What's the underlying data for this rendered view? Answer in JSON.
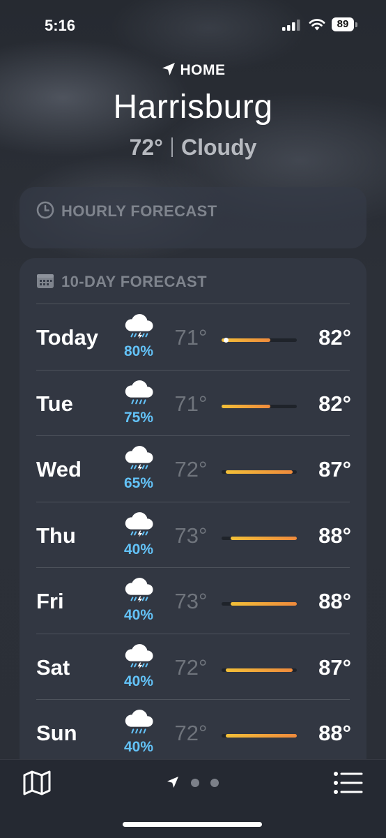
{
  "status_bar": {
    "time": "5:16",
    "battery": "89"
  },
  "header": {
    "location_label": "HOME",
    "city": "Harrisburg",
    "current_temp": "72°",
    "current_condition": "Cloudy"
  },
  "hourly": {
    "title": "HOURLY FORECAST"
  },
  "daily": {
    "title": "10-DAY FORECAST",
    "range_min": 71,
    "range_max": 88,
    "current_temp_value": 72,
    "days": [
      {
        "day": "Today",
        "icon": "thunderstorm-rain-icon",
        "precip": "80%",
        "low": "71°",
        "high": "82°",
        "low_value": 71,
        "high_value": 82
      },
      {
        "day": "Tue",
        "icon": "cloud-rain-icon",
        "precip": "75%",
        "low": "71°",
        "high": "82°",
        "low_value": 71,
        "high_value": 82
      },
      {
        "day": "Wed",
        "icon": "thunderstorm-rain-icon",
        "precip": "65%",
        "low": "72°",
        "high": "87°",
        "low_value": 72,
        "high_value": 87
      },
      {
        "day": "Thu",
        "icon": "thunderstorm-rain-icon",
        "precip": "40%",
        "low": "73°",
        "high": "88°",
        "low_value": 73,
        "high_value": 88
      },
      {
        "day": "Fri",
        "icon": "thunderstorm-rain-icon",
        "precip": "40%",
        "low": "73°",
        "high": "88°",
        "low_value": 73,
        "high_value": 88
      },
      {
        "day": "Sat",
        "icon": "thunderstorm-rain-icon",
        "precip": "40%",
        "low": "72°",
        "high": "87°",
        "low_value": 72,
        "high_value": 87
      },
      {
        "day": "Sun",
        "icon": "cloud-rain-icon",
        "precip": "40%",
        "low": "72°",
        "high": "88°",
        "low_value": 72,
        "high_value": 88
      }
    ]
  },
  "tab_bar": {
    "page_count": 3,
    "active_page": 0
  },
  "colors": {
    "precip": "#63c2f7",
    "bar_cool": "#f3c038",
    "bar_warm": "#ef8a3c",
    "track": "#1f232a"
  }
}
